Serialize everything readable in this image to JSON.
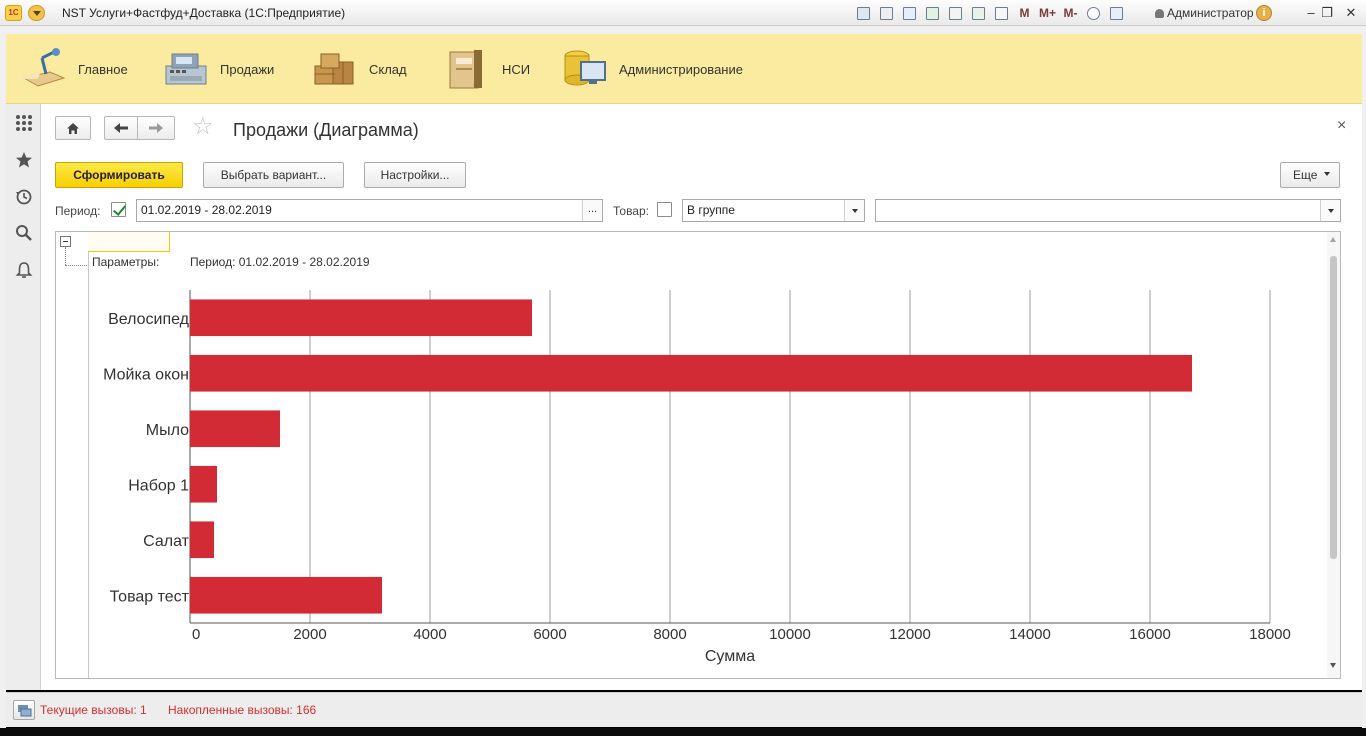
{
  "window": {
    "title": "NST Услуги+Фастфуд+Доставка  (1С:Предприятие)",
    "user": "Администратор",
    "memory_buttons": [
      "M",
      "M+",
      "M-"
    ]
  },
  "sections": [
    {
      "label": "Главное",
      "icon": "desk-lamp-icon"
    },
    {
      "label": "Продажи",
      "icon": "cash-register-icon"
    },
    {
      "label": "Склад",
      "icon": "warehouse-boxes-icon"
    },
    {
      "label": "НСИ",
      "icon": "binder-folder-icon"
    },
    {
      "label": "Администрирование",
      "icon": "database-monitor-icon"
    }
  ],
  "sidebar_icons": [
    "apps-grid-icon",
    "favorites-star-icon",
    "history-icon",
    "search-icon",
    "notifications-bell-icon"
  ],
  "page": {
    "title": "Продажи (Диаграмма)",
    "close": "×"
  },
  "toolbar": {
    "generate": "Сформировать",
    "choose_variant": "Выбрать вариант...",
    "settings": "Настройки...",
    "more": "Еще"
  },
  "filters": {
    "period_label": "Период:",
    "period_checked": true,
    "period_value": "01.02.2019 - 28.02.2019",
    "period_button": "...",
    "product_label": "Товар:",
    "product_checked": false,
    "comparison": "В группе",
    "product_value": ""
  },
  "report": {
    "params_label": "Параметры:",
    "params_value": "Период: 01.02.2019 - 28.02.2019"
  },
  "chart_data": {
    "type": "bar",
    "orientation": "horizontal",
    "categories": [
      "Велосипед",
      "Мойка окон",
      "Мыло",
      "Набор 1",
      "Салат",
      "Товар тест"
    ],
    "values": [
      5700,
      16700,
      1500,
      450,
      400,
      3200
    ],
    "xlabel": "Сумма",
    "ylabel": "",
    "xlim": [
      0,
      18000
    ],
    "ticks": [
      "0",
      "2000",
      "4000",
      "6000",
      "8000",
      "10000",
      "12000",
      "14000",
      "16000",
      "18000"
    ],
    "grid": true,
    "bar_color": "#d22b36"
  },
  "status": {
    "current_calls": "Текущие вызовы: 1",
    "accumulated_calls": "Накопленные вызовы: 166"
  }
}
